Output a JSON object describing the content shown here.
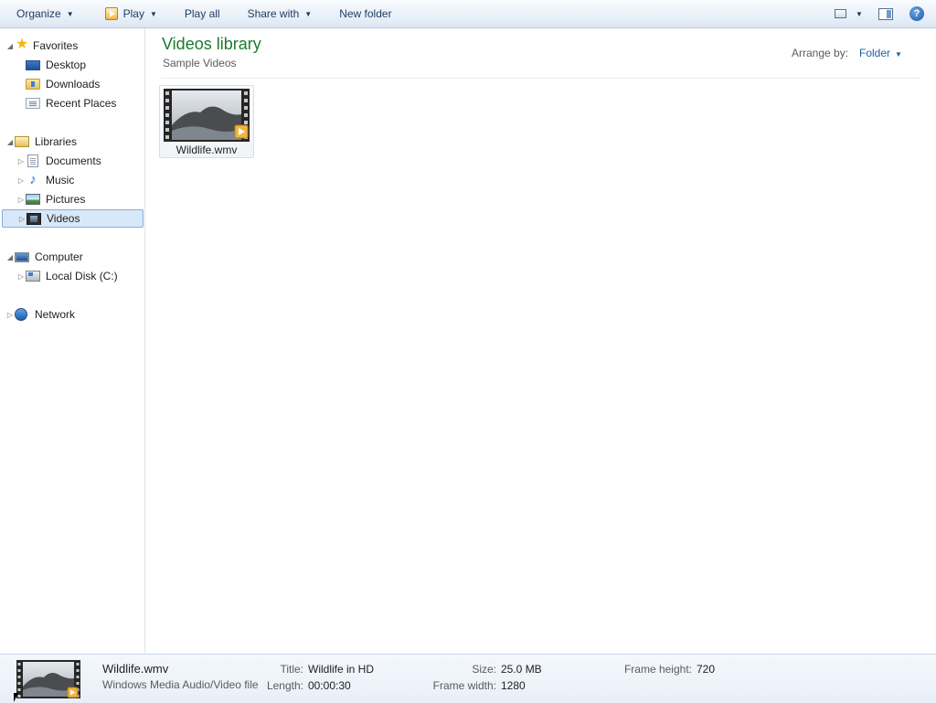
{
  "toolbar": {
    "organize": "Organize",
    "play": "Play",
    "play_all": "Play all",
    "share_with": "Share with",
    "new_folder": "New folder",
    "help_glyph": "?",
    "caret_glyph": "▼"
  },
  "nav": {
    "favorites": {
      "label": "Favorites",
      "items": [
        "Desktop",
        "Downloads",
        "Recent Places"
      ]
    },
    "libraries": {
      "label": "Libraries",
      "items": [
        "Documents",
        "Music",
        "Pictures",
        "Videos"
      ],
      "selected": "Videos"
    },
    "computer": {
      "label": "Computer",
      "items": [
        "Local Disk (C:)"
      ]
    },
    "network": {
      "label": "Network"
    },
    "expanded_glyph": "◢",
    "collapsed_glyph": "▷",
    "icons": {
      "favorites": "star-icon",
      "desktop": "desktop-icon",
      "downloads": "downloads-folder-icon",
      "recent_places": "recent-places-icon",
      "libraries": "libraries-icon",
      "documents": "documents-icon",
      "music": "music-note-icon",
      "pictures": "pictures-icon",
      "videos": "videos-icon",
      "computer": "computer-icon",
      "local_disk": "hard-disk-icon",
      "network": "network-icon"
    }
  },
  "content": {
    "title": "Videos library",
    "subtitle": "Sample Videos",
    "arrange_label": "Arrange by:",
    "arrange_value": "Folder",
    "files": [
      {
        "name": "Wildlife.wmv"
      }
    ]
  },
  "details": {
    "name": "Wildlife.wmv",
    "type": "Windows Media Audio/Video file",
    "title_label": "Title:",
    "title_value": "Wildlife in HD",
    "length_label": "Length:",
    "length_value": "00:00:30",
    "size_label": "Size:",
    "size_value": "25.0 MB",
    "frame_width_label": "Frame width:",
    "frame_width_value": "1280",
    "frame_height_label": "Frame height:",
    "frame_height_value": "720"
  },
  "colors": {
    "library_title": "#1d7a2f",
    "link_blue": "#1c5ea8",
    "selection_fill": "#d9e8f8",
    "selection_border": "#84acdd"
  }
}
